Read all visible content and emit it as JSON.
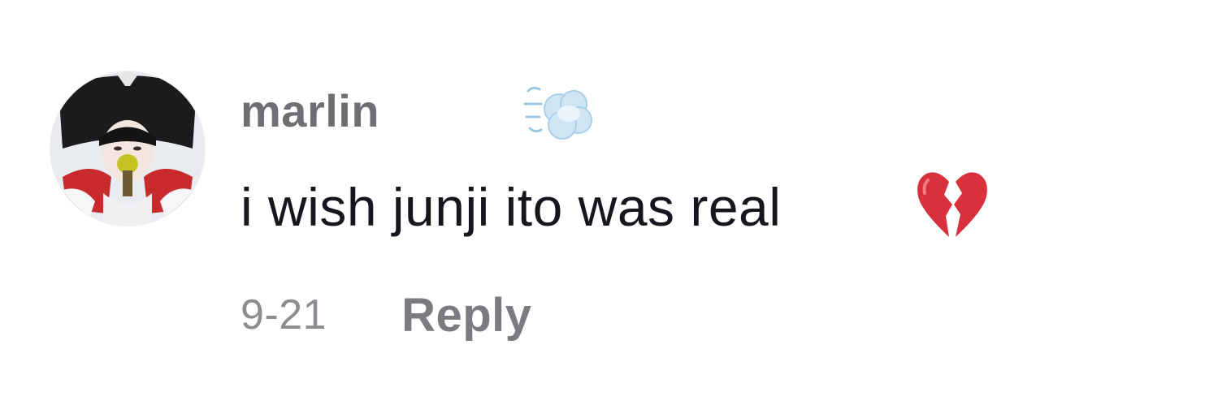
{
  "comment": {
    "username": "marlin",
    "username_emoji": "dash-emoji",
    "text": "i wish junji ito was real",
    "text_emoji": "broken-heart-emoji",
    "date": "9-21",
    "reply_label": "Reply",
    "avatar": "profile-photo"
  },
  "colors": {
    "username": "#6f6f73",
    "text": "#16161e",
    "meta": "#8c8c91",
    "heart": "#d8313b",
    "puff": "#b7d8ec"
  }
}
